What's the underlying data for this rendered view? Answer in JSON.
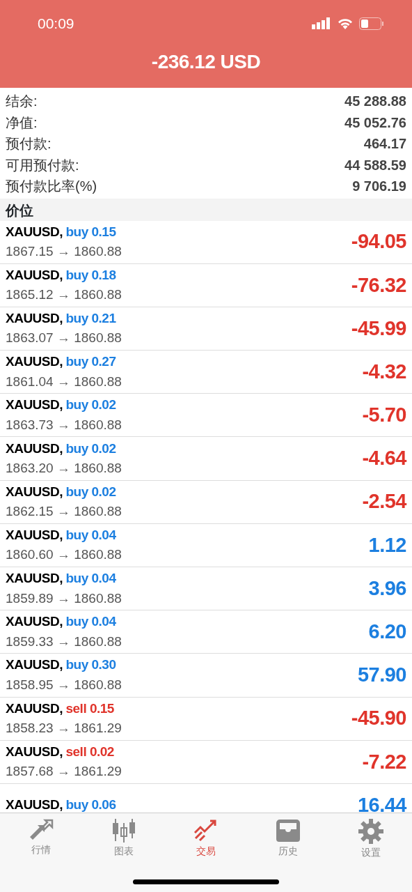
{
  "status_bar": {
    "time": "00:09"
  },
  "header": {
    "title": "-236.12 USD"
  },
  "summary": [
    {
      "label": "结余:",
      "value": "45 288.88"
    },
    {
      "label": "净值:",
      "value": "45 052.76"
    },
    {
      "label": "预付款:",
      "value": "464.17"
    },
    {
      "label": "可用预付款:",
      "value": "44 588.59"
    },
    {
      "label": "预付款比率(%)",
      "value": "9 706.19"
    }
  ],
  "section": "价位",
  "positions": [
    {
      "symbol": "XAUUSD,",
      "side": "buy",
      "short": false,
      "lots": "0.15",
      "prices": "1867.15 → 1860.88",
      "profit": "-94.05",
      "loss": true
    },
    {
      "symbol": "XAUUSD,",
      "side": "buy",
      "short": false,
      "lots": "0.18",
      "prices": "1865.12 → 1860.88",
      "profit": "-76.32",
      "loss": true
    },
    {
      "symbol": "XAUUSD,",
      "side": "buy",
      "short": false,
      "lots": "0.21",
      "prices": "1863.07 → 1860.88",
      "profit": "-45.99",
      "loss": true
    },
    {
      "symbol": "XAUUSD,",
      "side": "buy",
      "short": false,
      "lots": "0.27",
      "prices": "1861.04 → 1860.88",
      "profit": "-4.32",
      "loss": true
    },
    {
      "symbol": "XAUUSD,",
      "side": "buy",
      "short": false,
      "lots": "0.02",
      "prices": "1863.73 → 1860.88",
      "profit": "-5.70",
      "loss": true
    },
    {
      "symbol": "XAUUSD,",
      "side": "buy",
      "short": false,
      "lots": "0.02",
      "prices": "1863.20 → 1860.88",
      "profit": "-4.64",
      "loss": true
    },
    {
      "symbol": "XAUUSD,",
      "side": "buy",
      "short": false,
      "lots": "0.02",
      "prices": "1862.15 → 1860.88",
      "profit": "-2.54",
      "loss": true
    },
    {
      "symbol": "XAUUSD,",
      "side": "buy",
      "short": false,
      "lots": "0.04",
      "prices": "1860.60 → 1860.88",
      "profit": "1.12",
      "loss": false
    },
    {
      "symbol": "XAUUSD,",
      "side": "buy",
      "short": false,
      "lots": "0.04",
      "prices": "1859.89 → 1860.88",
      "profit": "3.96",
      "loss": false
    },
    {
      "symbol": "XAUUSD,",
      "side": "buy",
      "short": false,
      "lots": "0.04",
      "prices": "1859.33 → 1860.88",
      "profit": "6.20",
      "loss": false
    },
    {
      "symbol": "XAUUSD,",
      "side": "buy",
      "short": false,
      "lots": "0.30",
      "prices": "1858.95 → 1860.88",
      "profit": "57.90",
      "loss": false
    },
    {
      "symbol": "XAUUSD,",
      "side": "sell",
      "short": true,
      "lots": "0.15",
      "prices": "1858.23 → 1861.29",
      "profit": "-45.90",
      "loss": true
    },
    {
      "symbol": "XAUUSD,",
      "side": "sell",
      "short": true,
      "lots": "0.02",
      "prices": "1857.68 → 1861.29",
      "profit": "-7.22",
      "loss": true
    },
    {
      "symbol": "XAUUSD,",
      "side": "buy",
      "short": false,
      "lots": "0.06",
      "profit": "16.44",
      "loss": false
    }
  ],
  "tabs": [
    {
      "label": "行情",
      "kind": "quotes",
      "selected": false
    },
    {
      "label": "图表",
      "kind": "chart",
      "selected": false
    },
    {
      "label": "交易",
      "kind": "trade",
      "selected": true
    },
    {
      "label": "历史",
      "kind": "history",
      "selected": false
    },
    {
      "label": "设置",
      "kind": "settings",
      "selected": false
    }
  ]
}
